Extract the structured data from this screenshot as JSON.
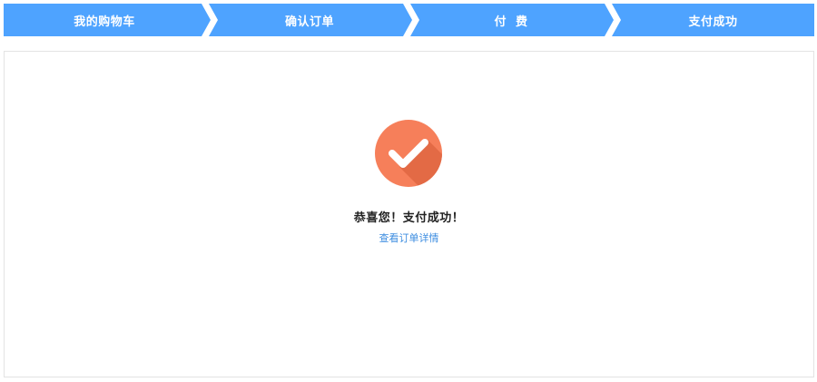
{
  "steps": [
    {
      "label": "我的购物车"
    },
    {
      "label": "确认订单"
    },
    {
      "label": "付  费"
    },
    {
      "label": "支付成功"
    }
  ],
  "colors": {
    "step_bar": "#4ea3ff",
    "separator": "#ffffff",
    "success_circle": "#f67f5a",
    "success_shadow": "#e36a45",
    "link": "#3d8de0"
  },
  "result": {
    "icon": "check-circle-icon",
    "message": "恭喜您！支付成功！",
    "order_link_label": "查看订单详情"
  }
}
